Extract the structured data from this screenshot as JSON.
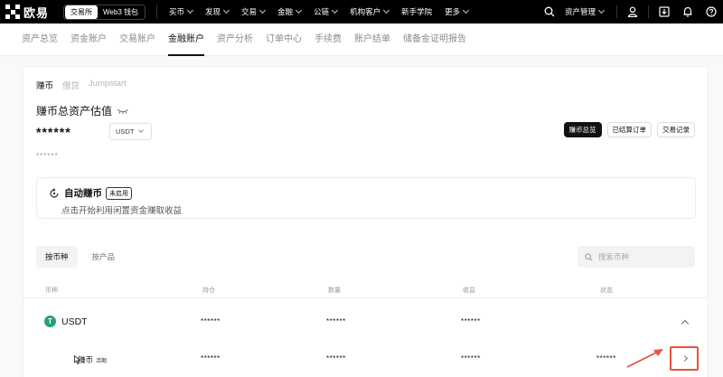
{
  "header": {
    "logo_text": "欧易",
    "modes": [
      {
        "label": "交易所",
        "active": true
      },
      {
        "label": "Web3 钱包",
        "active": false
      }
    ],
    "nav": [
      {
        "label": "买币"
      },
      {
        "label": "发现"
      },
      {
        "label": "交易"
      },
      {
        "label": "金融"
      },
      {
        "label": "公链"
      },
      {
        "label": "机构客户"
      },
      {
        "label": "新手学院"
      },
      {
        "label": "更多"
      }
    ],
    "asset_menu_label": "资产管理"
  },
  "subnav": [
    {
      "label": "资产总览",
      "active": false
    },
    {
      "label": "资金账户",
      "active": false
    },
    {
      "label": "交易账户",
      "active": false
    },
    {
      "label": "金融账户",
      "active": true
    },
    {
      "label": "资产分析",
      "active": false
    },
    {
      "label": "订单中心",
      "active": false
    },
    {
      "label": "手续费",
      "active": false
    },
    {
      "label": "账户结单",
      "active": false
    },
    {
      "label": "储备金证明报告",
      "active": false
    }
  ],
  "account_tabs": [
    {
      "label": "赚币",
      "active": true
    },
    {
      "label": "借贷",
      "active": false
    },
    {
      "label": "Jumpstart",
      "active": false
    }
  ],
  "summary": {
    "title": "赚币总资产估值",
    "balance_masked": "******",
    "unit": "USDT",
    "sub_balance_masked": "******"
  },
  "actions": [
    {
      "label": "赚币总览",
      "primary": true
    },
    {
      "label": "已结算订单",
      "primary": false
    },
    {
      "label": "交易记录",
      "primary": false
    }
  ],
  "auto_earn": {
    "title": "自动赚币",
    "status_badge": "未启用",
    "description": "点击开始利用闲置资金赚取收益"
  },
  "view_tabs": [
    {
      "label": "按币种",
      "active": true
    },
    {
      "label": "按产品",
      "active": false
    }
  ],
  "search": {
    "placeholder": "搜索币种"
  },
  "table": {
    "headers": [
      "币种",
      "持仓",
      "数量",
      "收益",
      "状态"
    ],
    "rows": [
      {
        "coin": "USDT",
        "coin_icon": "T",
        "holding": "******",
        "amount": "******",
        "earnings": "******"
      }
    ],
    "sub_rows": [
      {
        "label": "赚币",
        "tag": "活期",
        "holding": "******",
        "amount": "******",
        "earnings": "******",
        "status": "******"
      }
    ]
  },
  "colors": {
    "accent": "#121212",
    "tether_green": "#26a17b",
    "annotation_red": "#e5533d"
  }
}
